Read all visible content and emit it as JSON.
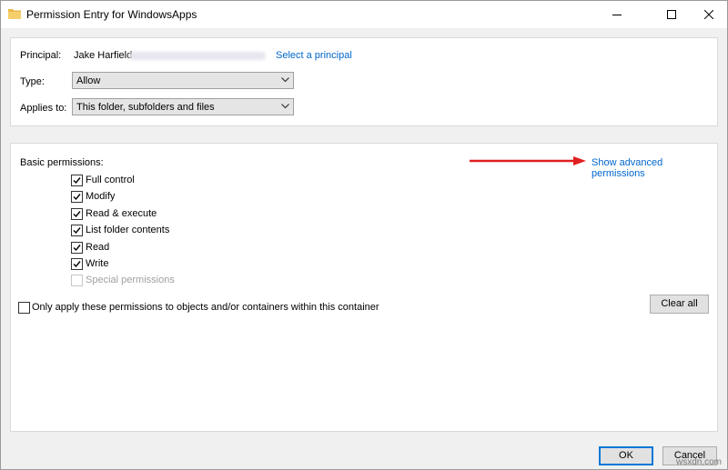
{
  "window": {
    "title": "Permission Entry for WindowsApps",
    "folder_icon_color": "#e8b84a"
  },
  "principal": {
    "label": "Principal:",
    "name": "Jake Harfield",
    "select_link": "Select a principal"
  },
  "type": {
    "label": "Type:",
    "value": "Allow"
  },
  "applies_to": {
    "label": "Applies to:",
    "value": "This folder, subfolders and files"
  },
  "permissions": {
    "heading": "Basic permissions:",
    "advanced_link": "Show advanced permissions",
    "items": [
      {
        "label": "Full control",
        "checked": true,
        "enabled": true
      },
      {
        "label": "Modify",
        "checked": true,
        "enabled": true
      },
      {
        "label": "Read & execute",
        "checked": true,
        "enabled": true
      },
      {
        "label": "List folder contents",
        "checked": true,
        "enabled": true
      },
      {
        "label": "Read",
        "checked": true,
        "enabled": true
      },
      {
        "label": "Write",
        "checked": true,
        "enabled": true
      },
      {
        "label": "Special permissions",
        "checked": false,
        "enabled": false
      }
    ],
    "only_apply_label": "Only apply these permissions to objects and/or containers within this container",
    "only_apply_checked": false,
    "clear_all": "Clear all"
  },
  "footer": {
    "ok": "OK",
    "cancel": "Cancel"
  },
  "watermark": "wsxdn.com",
  "colors": {
    "link": "#0066cc",
    "annotation_arrow": "#e02020",
    "default_button_border": "#0078d7"
  }
}
